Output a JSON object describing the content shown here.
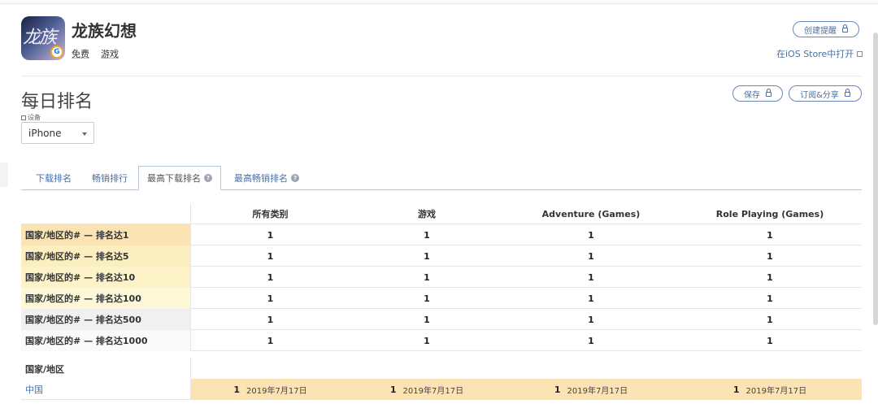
{
  "app": {
    "title": "龙族幻想",
    "price": "免费",
    "genre": "游戏",
    "icon_text": "龙族",
    "create_alert": "创建提醒",
    "open_ios_store": "在iOS Store中打开"
  },
  "section": {
    "title": "每日排名",
    "save": "保存",
    "subscribe_share": "订阅&分享",
    "device_label": "设备",
    "device_value": "iPhone"
  },
  "tabs": [
    {
      "label": "下载排名",
      "active": false,
      "help": false
    },
    {
      "label": "畅销排行",
      "active": false,
      "help": false
    },
    {
      "label": "最高下载排名",
      "active": true,
      "help": true
    },
    {
      "label": "最高畅销排名",
      "active": false,
      "help": true
    }
  ],
  "table": {
    "columns": [
      "所有类别",
      "游戏",
      "Adventure (Games)",
      "Role Playing (Games)"
    ],
    "rows": [
      {
        "label": "国家/地区的# — 排名达1",
        "values": [
          "1",
          "1",
          "1",
          "1"
        ],
        "color": "#fbe3b4"
      },
      {
        "label": "国家/地区的# — 排名达5",
        "values": [
          "1",
          "1",
          "1",
          "1"
        ],
        "color": "#fcefbf"
      },
      {
        "label": "国家/地区的# — 排名达10",
        "values": [
          "1",
          "1",
          "1",
          "1"
        ],
        "color": "#fdf3c8"
      },
      {
        "label": "国家/地区的# — 排名达100",
        "values": [
          "1",
          "1",
          "1",
          "1"
        ],
        "color": "#fdf8d8"
      },
      {
        "label": "国家/地区的# — 排名达500",
        "values": [
          "1",
          "1",
          "1",
          "1"
        ],
        "color": "#f0f0f0"
      },
      {
        "label": "国家/地区的# — 排名达1000",
        "values": [
          "1",
          "1",
          "1",
          "1"
        ],
        "color": "#fafafa"
      }
    ],
    "country_header": "国家/地区",
    "countries": [
      {
        "name": "中国",
        "ranks": [
          {
            "rank": "1",
            "date": "2019年7月17日"
          },
          {
            "rank": "1",
            "date": "2019年7月17日"
          },
          {
            "rank": "1",
            "date": "2019年7月17日"
          },
          {
            "rank": "1",
            "date": "2019年7月17日"
          }
        ],
        "color": "#fbe3b4"
      }
    ]
  },
  "colors": {
    "accent": "#4a6fa5",
    "highlight": "#fbe3b4"
  }
}
